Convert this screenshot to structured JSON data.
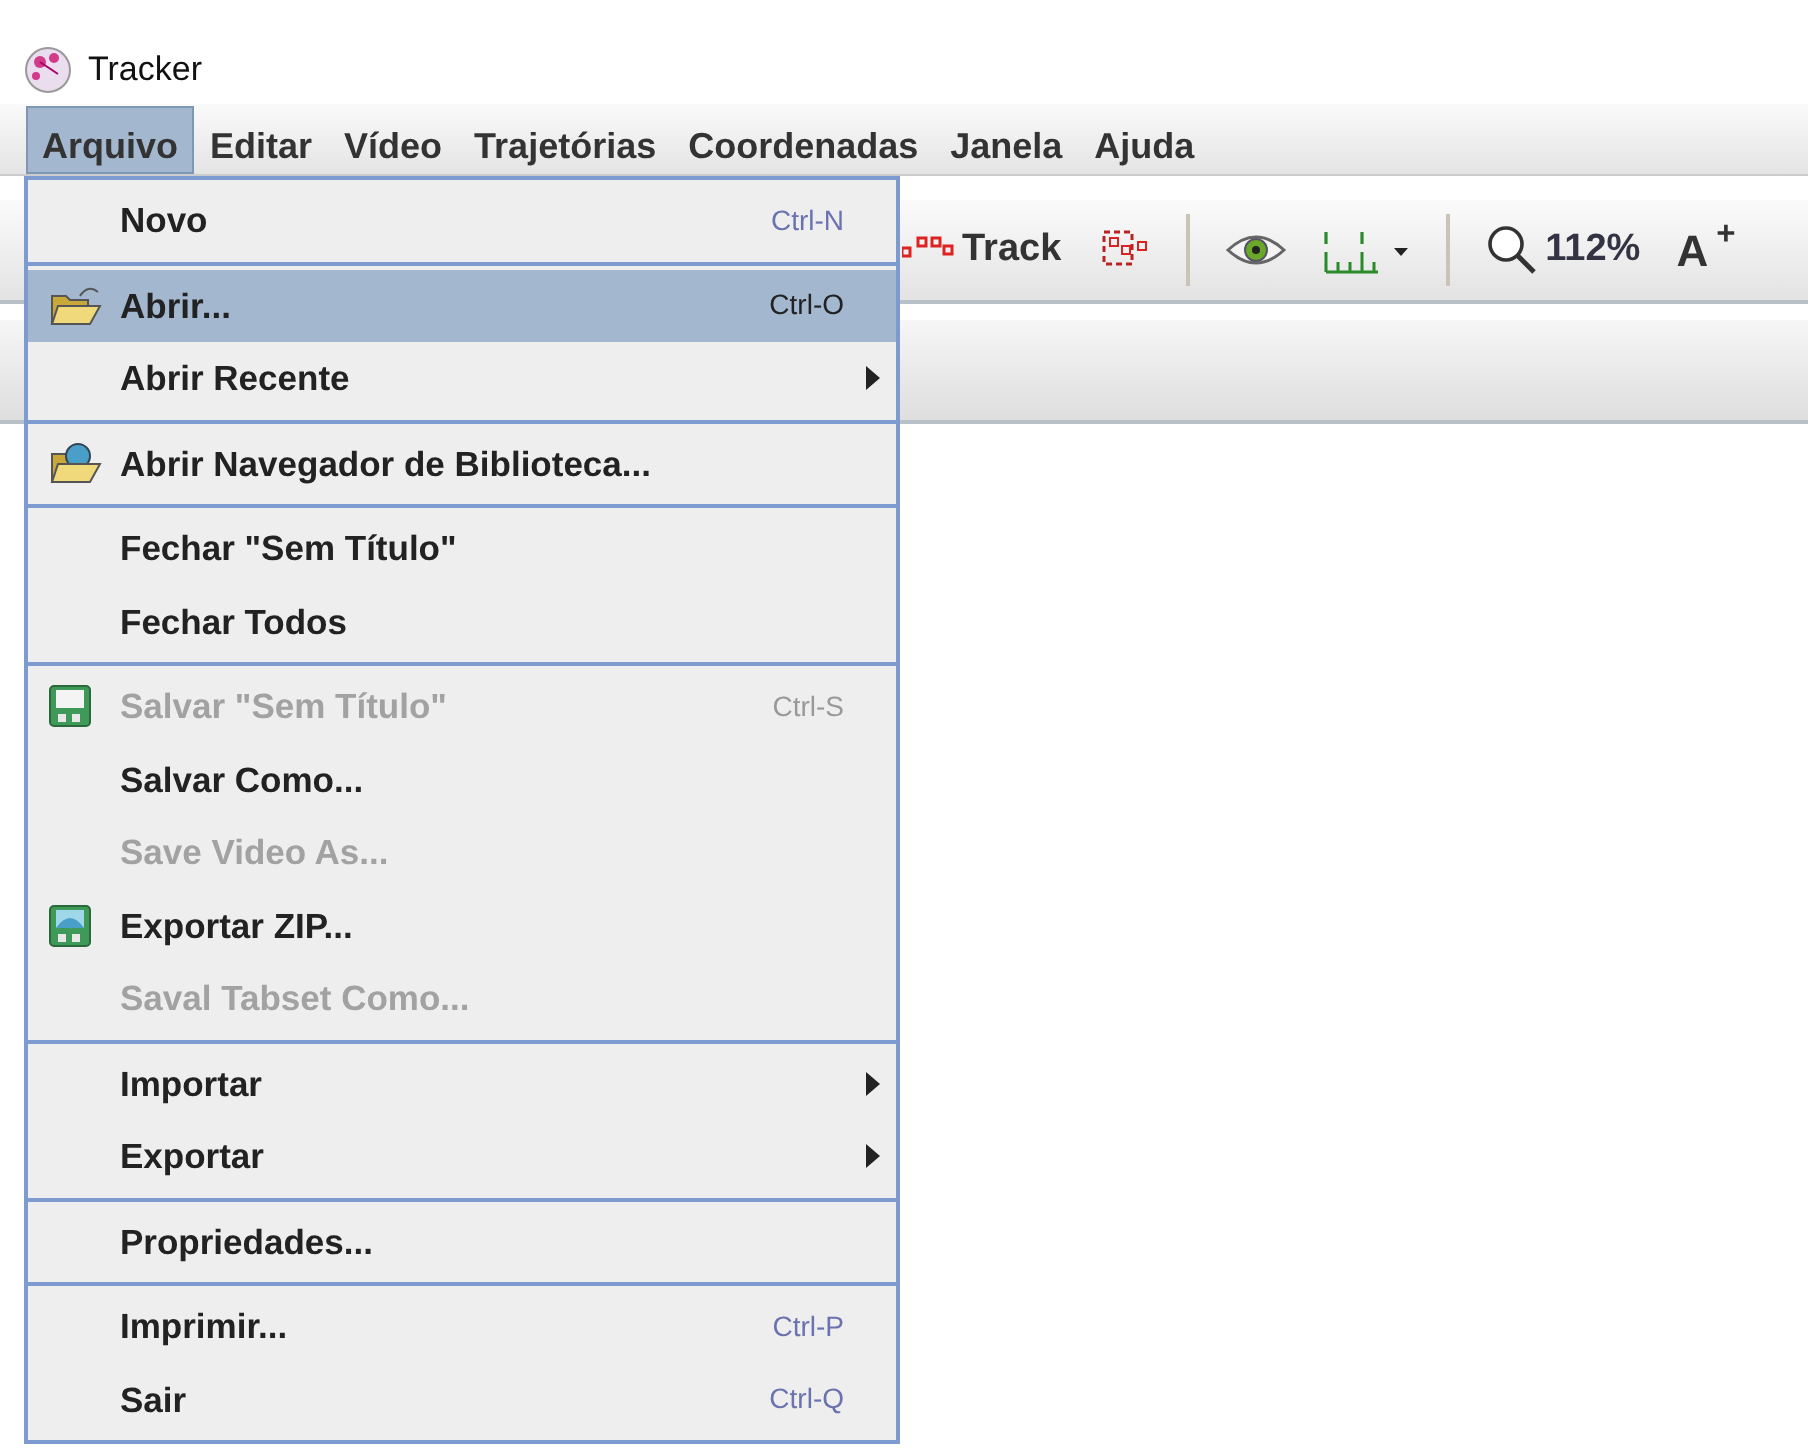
{
  "window": {
    "title": "Tracker"
  },
  "menubar": [
    {
      "label": "Arquivo",
      "selected": true
    },
    {
      "label": "Editar",
      "selected": false
    },
    {
      "label": "Vídeo",
      "selected": false
    },
    {
      "label": "Trajetórias",
      "selected": false
    },
    {
      "label": "Coordenadas",
      "selected": false
    },
    {
      "label": "Janela",
      "selected": false
    },
    {
      "label": "Ajuda",
      "selected": false
    }
  ],
  "toolbar": {
    "track_label": "Track",
    "zoom": "112%",
    "font_size": "A$^{+}$"
  },
  "file_menu": [
    [
      {
        "kind": "plain",
        "label": "Novo",
        "shortcut": "Ctrl-N",
        "submenu": false,
        "disabled": false,
        "selected": false
      }
    ],
    [
      {
        "kind": "open",
        "label": "Abrir...",
        "shortcut": "Ctrl-O",
        "submenu": false,
        "disabled": false,
        "selected": true
      },
      {
        "kind": "plain",
        "label": "Abrir Recente",
        "submenu": true,
        "disabled": false,
        "selected": false
      }
    ],
    [
      {
        "kind": "library",
        "label": "Abrir Navegador de Biblioteca...",
        "submenu": false,
        "disabled": false,
        "selected": false
      }
    ],
    [
      {
        "kind": "plain",
        "label": "Fechar \"Sem Título\"",
        "submenu": false,
        "disabled": false,
        "selected": false
      },
      {
        "kind": "plain",
        "label": "Fechar Todos",
        "submenu": false,
        "disabled": false,
        "selected": false
      }
    ],
    [
      {
        "kind": "save",
        "label": "Salvar \"Sem Título\"",
        "shortcut": "Ctrl-S",
        "submenu": false,
        "disabled": true,
        "selected": false
      },
      {
        "kind": "plain",
        "label": "Salvar Como...",
        "submenu": false,
        "disabled": false,
        "selected": false
      },
      {
        "kind": "plain",
        "label": "Save Video As...",
        "submenu": false,
        "disabled": true,
        "selected": false
      },
      {
        "kind": "zip",
        "label": "Exportar ZIP...",
        "submenu": false,
        "disabled": false,
        "selected": false
      },
      {
        "kind": "plain",
        "label": "Saval Tabset Como...",
        "submenu": false,
        "disabled": true,
        "selected": false
      }
    ],
    [
      {
        "kind": "plain",
        "label": "Importar",
        "submenu": true,
        "disabled": false,
        "selected": false
      },
      {
        "kind": "plain",
        "label": "Exportar",
        "submenu": true,
        "disabled": false,
        "selected": false
      }
    ],
    [
      {
        "kind": "plain",
        "label": "Propriedades...",
        "submenu": false,
        "disabled": false,
        "selected": false
      }
    ],
    [
      {
        "kind": "plain",
        "label": "Imprimir...",
        "shortcut": "Ctrl-P",
        "submenu": false,
        "disabled": false,
        "selected": false
      },
      {
        "kind": "plain",
        "label": "Sair",
        "shortcut": "Ctrl-Q",
        "submenu": false,
        "disabled": false,
        "selected": false
      }
    ]
  ]
}
